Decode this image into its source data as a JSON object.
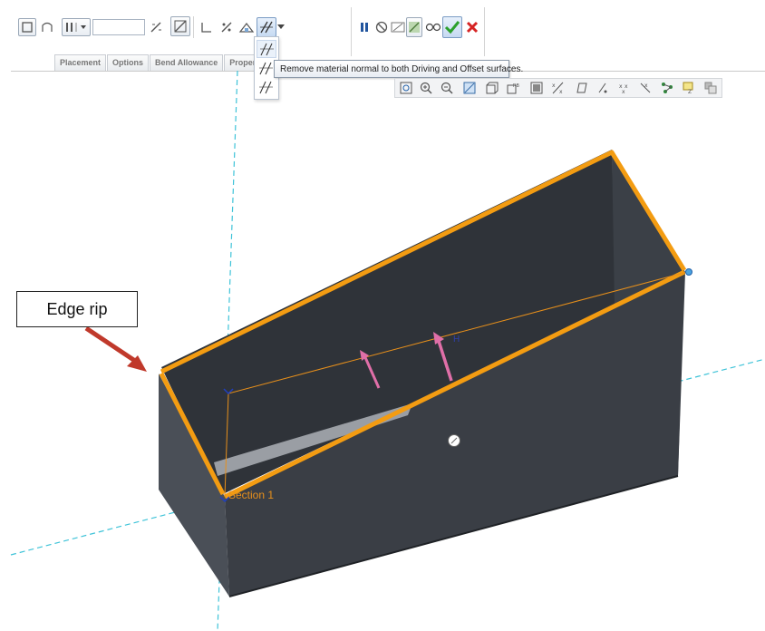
{
  "toolbar": {
    "thickness_value": "",
    "tabs": [
      "Placement",
      "Options",
      "Bend Allowance",
      "Properties"
    ],
    "tooltip": "Remove material normal to both Driving and Offset surfaces."
  },
  "annotations": {
    "callout": "Edge rip",
    "section_label": "Section 1",
    "h_label": "H"
  },
  "colors": {
    "accent_edge": "#f39c12",
    "model_body": "#3a3e45",
    "datum_line": "#3ec3d8",
    "ok_green": "#2ca02c",
    "cancel_red": "#d62424",
    "callout_arrow": "#c0392b"
  },
  "icons": {
    "pause": "pause-icon",
    "ok": "checkmark-icon",
    "cancel": "x-icon",
    "glasses": "preview-glasses-icon"
  }
}
